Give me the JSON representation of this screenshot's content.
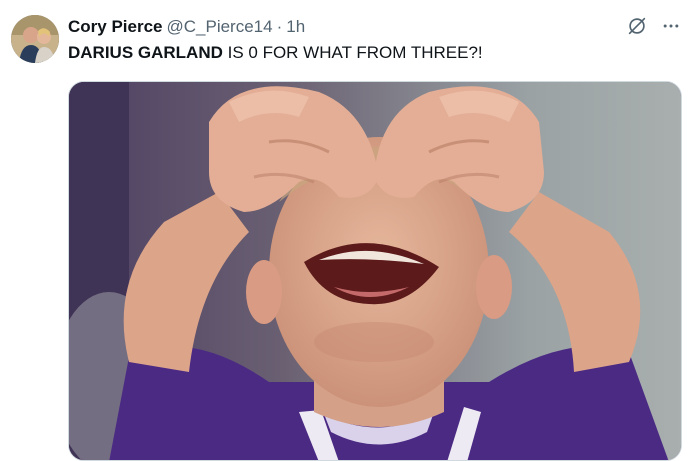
{
  "tweet": {
    "author_name": "Cory Pierce",
    "author_handle": "@C_Pierce14",
    "separator": "·",
    "time": "1h",
    "text_bold": "DARIUS GARLAND",
    "text_rest": " IS 0 FOR WHAT FROM THREE?!",
    "media_description": "Crying boy covering his eyes with both hands"
  },
  "icons": {
    "grok": "grok-icon",
    "more": "more-icon"
  },
  "colors": {
    "text_primary": "#0f1419",
    "text_secondary": "#536471",
    "jersey_purple": "#4b2a84"
  }
}
